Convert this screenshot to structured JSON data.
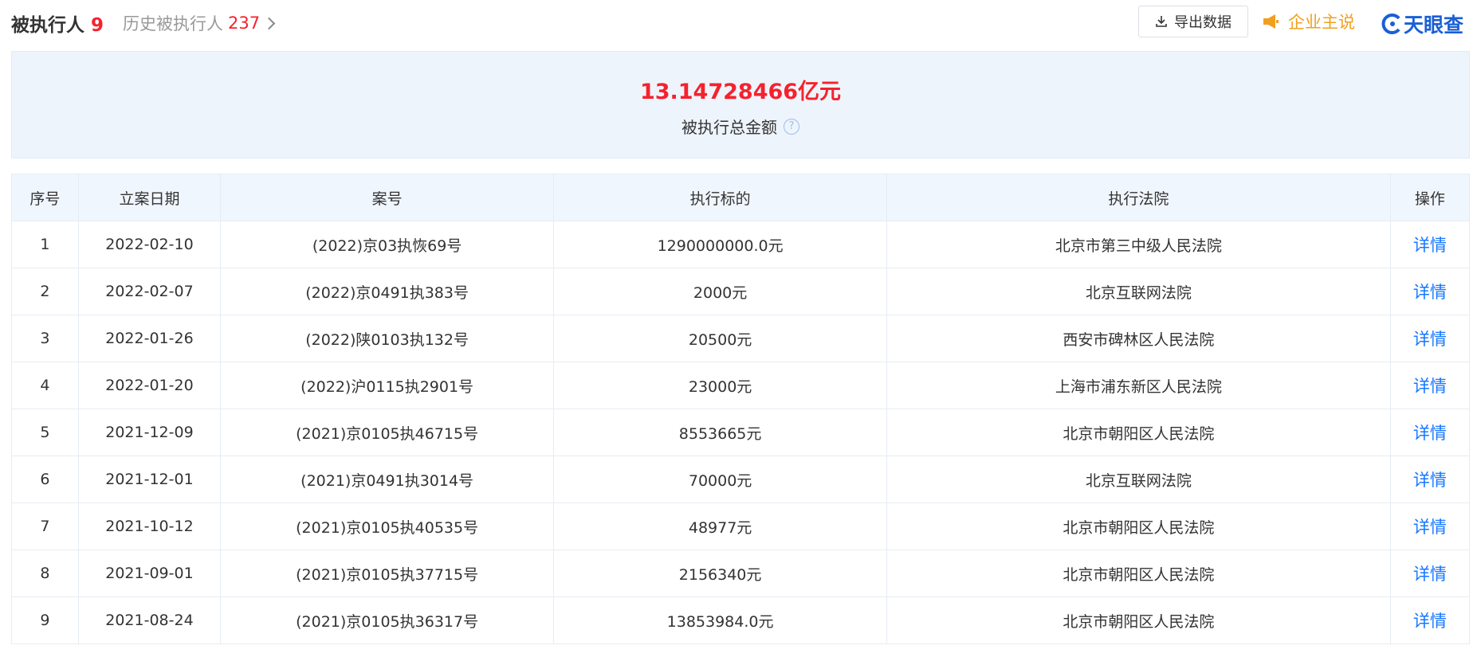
{
  "tabs": {
    "current_label": "被执行人",
    "current_count": "9",
    "history_label": "历史被执行人",
    "history_count": "237"
  },
  "toolbar": {
    "export_label": "导出数据",
    "owner_label": "企业主说",
    "logo_text": "天眼查"
  },
  "summary": {
    "amount": "13.14728466亿元",
    "label": "被执行总金额",
    "help_icon": "?"
  },
  "table": {
    "headers": [
      "序号",
      "立案日期",
      "案号",
      "执行标的",
      "执行法院",
      "操作"
    ],
    "rows": [
      {
        "no": "1",
        "date": "2022-02-10",
        "case": "(2022)京03执恢69号",
        "amount": "1290000000.0元",
        "court": "北京市第三中级人民法院",
        "op": "详情"
      },
      {
        "no": "2",
        "date": "2022-02-07",
        "case": "(2022)京0491执383号",
        "amount": "2000元",
        "court": "北京互联网法院",
        "op": "详情"
      },
      {
        "no": "3",
        "date": "2022-01-26",
        "case": "(2022)陕0103执132号",
        "amount": "20500元",
        "court": "西安市碑林区人民法院",
        "op": "详情"
      },
      {
        "no": "4",
        "date": "2022-01-20",
        "case": "(2022)沪0115执2901号",
        "amount": "23000元",
        "court": "上海市浦东新区人民法院",
        "op": "详情"
      },
      {
        "no": "5",
        "date": "2021-12-09",
        "case": "(2021)京0105执46715号",
        "amount": "8553665元",
        "court": "北京市朝阳区人民法院",
        "op": "详情"
      },
      {
        "no": "6",
        "date": "2021-12-01",
        "case": "(2021)京0491执3014号",
        "amount": "70000元",
        "court": "北京互联网法院",
        "op": "详情"
      },
      {
        "no": "7",
        "date": "2021-10-12",
        "case": "(2021)京0105执40535号",
        "amount": "48977元",
        "court": "北京市朝阳区人民法院",
        "op": "详情"
      },
      {
        "no": "8",
        "date": "2021-09-01",
        "case": "(2021)京0105执37715号",
        "amount": "2156340元",
        "court": "北京市朝阳区人民法院",
        "op": "详情"
      },
      {
        "no": "9",
        "date": "2021-08-24",
        "case": "(2021)京0105执36317号",
        "amount": "13853984.0元",
        "court": "北京市朝阳区人民法院",
        "op": "详情"
      }
    ]
  },
  "colors": {
    "accent_red": "#f5222d",
    "link_blue": "#1677ff",
    "owner_orange": "#f0a020",
    "logo_blue": "#1a5fd6"
  }
}
